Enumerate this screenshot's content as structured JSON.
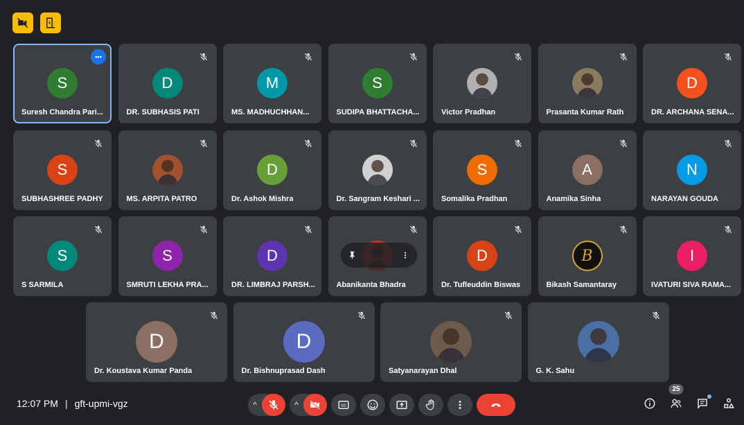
{
  "colors": {
    "background": "#202124",
    "tile": "#3c4043",
    "active_border": "#8ab4f8",
    "end_call": "#ea4335",
    "top_button": "#fbbc04"
  },
  "topbar": {
    "buttons": [
      {
        "icon": "no-video-icon"
      },
      {
        "icon": "leave-door-icon"
      }
    ]
  },
  "participants": [
    {
      "name": "Suresh Chandra Pari...",
      "initial": "S",
      "avatar_color": "#2e7d32",
      "type": "initial",
      "active": true
    },
    {
      "name": "DR. SUBHASIS PATI",
      "initial": "D",
      "avatar_color": "#00897b",
      "type": "initial"
    },
    {
      "name": "MS. MADHUCHHAN...",
      "initial": "M",
      "avatar_color": "#0097a7",
      "type": "initial"
    },
    {
      "name": "SUDIPA BHATTACHA...",
      "initial": "S",
      "avatar_color": "#2e7d32",
      "type": "initial"
    },
    {
      "name": "Victor Pradhan",
      "type": "photo",
      "photo_color": "#b0b0b0"
    },
    {
      "name": "Prasanta Kumar Rath",
      "type": "photo",
      "photo_color": "#8a7a60"
    },
    {
      "name": "DR. ARCHANA SENA...",
      "initial": "D",
      "avatar_color": "#f4511e",
      "type": "initial"
    },
    {
      "name": "SUBHASHREE PADHY",
      "initial": "S",
      "avatar_color": "#d84315",
      "type": "initial"
    },
    {
      "name": "MS. ARPITA PATRO",
      "type": "photo",
      "photo_color": "#a0522d"
    },
    {
      "name": "Dr. Ashok Mishra",
      "initial": "D",
      "avatar_color": "#689f38",
      "type": "initial"
    },
    {
      "name": "Dr. Sangram Keshari ...",
      "type": "photo",
      "photo_color": "#d0d0d0"
    },
    {
      "name": "Somalika Pradhan",
      "initial": "S",
      "avatar_color": "#ef6c00",
      "type": "initial"
    },
    {
      "name": "Anamika Sinha",
      "initial": "A",
      "avatar_color": "#8d6e63",
      "type": "initial"
    },
    {
      "name": "NARAYAN GOUDA",
      "initial": "N",
      "avatar_color": "#039be5",
      "type": "initial"
    },
    {
      "name": "S SARMILA",
      "initial": "S",
      "avatar_color": "#00897b",
      "type": "initial"
    },
    {
      "name": "SMRUTI LEKHA PRA...",
      "initial": "S",
      "avatar_color": "#8e24aa",
      "type": "initial"
    },
    {
      "name": "DR. LIMBRAJ PARSH...",
      "initial": "D",
      "avatar_color": "#5e35b1",
      "type": "initial"
    },
    {
      "name": "Abanikanta Bhadra",
      "type": "photo",
      "photo_color": "#c0392b",
      "pinned_overlay": true
    },
    {
      "name": "Dr. Tufleuddin Biswas",
      "initial": "D",
      "avatar_color": "#d84315",
      "type": "initial"
    },
    {
      "name": "Bikash Samantaray",
      "type": "logo",
      "logo_letter": "B",
      "photo_color": "#111111"
    },
    {
      "name": "IVATURI SIVA RAMA...",
      "initial": "I",
      "avatar_color": "#e91e63",
      "type": "initial"
    },
    {
      "name": "Dr. Koustava Kumar Panda",
      "initial": "D",
      "avatar_color": "#8d6e63",
      "type": "initial"
    },
    {
      "name": "Dr. Bishnuprasad Dash",
      "initial": "D",
      "avatar_color": "#5c6bc0",
      "type": "initial"
    },
    {
      "name": "Satyanarayan Dhal",
      "type": "photo",
      "photo_color": "#6d5a4a"
    },
    {
      "name": "G. K. Sahu",
      "type": "photo",
      "photo_color": "#4a6fa5"
    }
  ],
  "bottombar": {
    "time": "12:07 PM",
    "meeting_code": "gft-upmi-vgz",
    "participant_count": "25"
  }
}
